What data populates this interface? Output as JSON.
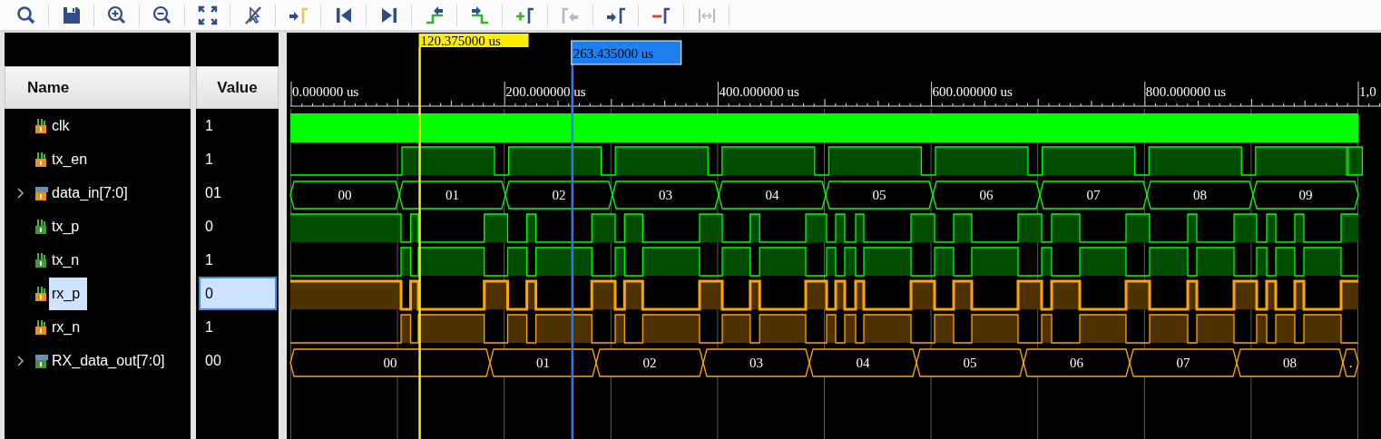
{
  "toolbar": [
    {
      "kind": "search",
      "disabled": false
    },
    {
      "kind": "save",
      "disabled": false
    },
    {
      "kind": "zoom-in",
      "disabled": false
    },
    {
      "kind": "zoom-out",
      "disabled": false
    },
    {
      "kind": "zoom-fit",
      "disabled": false
    },
    {
      "kind": "no-pointer",
      "disabled": false
    },
    {
      "kind": "to-cursor",
      "disabled": false
    },
    {
      "kind": "to-start",
      "disabled": false
    },
    {
      "kind": "to-end",
      "disabled": false
    },
    {
      "kind": "prev-edge",
      "disabled": false
    },
    {
      "kind": "next-edge",
      "disabled": false
    },
    {
      "kind": "add-marker",
      "disabled": false
    },
    {
      "kind": "prev-marker",
      "disabled": true
    },
    {
      "kind": "next-marker",
      "disabled": false
    },
    {
      "kind": "remove-marker",
      "disabled": false
    },
    {
      "kind": "swap-markers",
      "disabled": true
    }
  ],
  "cursors": [
    {
      "kind": "main",
      "label": "120.375000 us"
    },
    {
      "kind": "marker",
      "label": "263.435000 us"
    }
  ],
  "ruler": {
    "labels": [
      "0.000000 us",
      "200.000000 us",
      "400.000000 us",
      "600.000000 us",
      "800.000000 us",
      "1,0"
    ]
  },
  "columns": [
    "Name",
    "Value"
  ],
  "signals": [
    {
      "name": "clk",
      "value": "1",
      "kind": "clock",
      "is_output": false,
      "color": "#00ff00",
      "selected": false
    },
    {
      "name": "tx_en",
      "value": "1",
      "kind": "bit",
      "is_output": false,
      "color": "#00ff00",
      "selected": false
    },
    {
      "name": "data_in[7:0]",
      "value": "01",
      "kind": "bus",
      "is_output": false,
      "color": "#00ff00",
      "selected": false,
      "expanded": false,
      "segments": [
        "00",
        "01",
        "02",
        "03",
        "04",
        "05",
        "06",
        "07",
        "08",
        "09"
      ]
    },
    {
      "name": "tx_p",
      "value": "0",
      "kind": "bit",
      "is_output": true,
      "color": "#00ff00",
      "selected": false
    },
    {
      "name": "tx_n",
      "value": "1",
      "kind": "bit",
      "is_output": true,
      "color": "#00ff00",
      "selected": false
    },
    {
      "name": "rx_p",
      "value": "0",
      "kind": "bit",
      "is_output": false,
      "color": "#ffa500",
      "selected": true
    },
    {
      "name": "rx_n",
      "value": "1",
      "kind": "bit",
      "is_output": false,
      "color": "#ffa500",
      "selected": false
    },
    {
      "name": "RX_data_out[7:0]",
      "value": "00",
      "kind": "bus",
      "is_output": true,
      "color": "#ffa500",
      "selected": false,
      "expanded": false,
      "segments": [
        "00",
        "01",
        "02",
        "03",
        "04",
        "05",
        "06",
        "07",
        "08",
        "."
      ]
    }
  ]
}
